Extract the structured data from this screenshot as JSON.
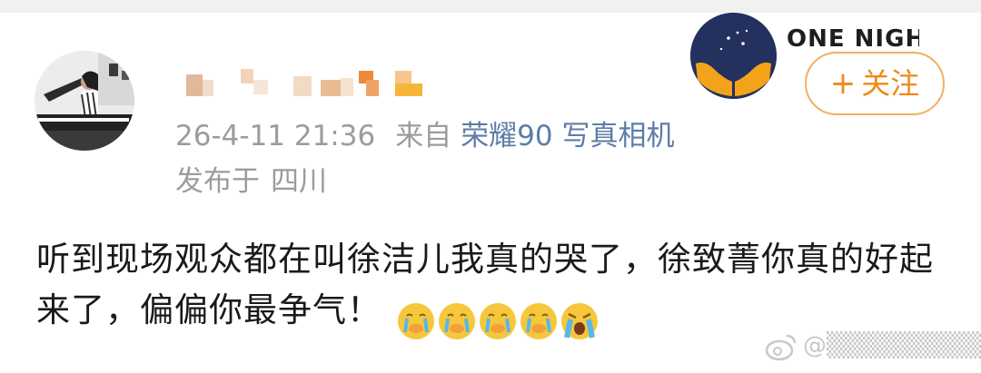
{
  "post": {
    "username_blurred": true,
    "timestamp": "26-4-11 21:36",
    "via_label": "来自",
    "device": "荣耀90 写真相机",
    "location_label": "发布于",
    "location": "四川",
    "text": "听到现场观众都在叫徐洁儿我真的哭了，徐致菁你真的好起来了，偏偏你最争气！",
    "emoji_count": 5
  },
  "header": {
    "badge_text": "ONE NIGHT",
    "follow_label": "关注",
    "follow_plus": "+"
  },
  "watermark": {
    "icon": "weibo-logo-icon",
    "text": "@▒▒▒▒▒▒▒▒▒"
  },
  "colors": {
    "follow_orange": "#ee8a1a",
    "device_link": "#5d7da7",
    "meta_gray": "#9c9c9c",
    "badge_navy": "#24305e",
    "badge_gold": "#f3a31a"
  }
}
